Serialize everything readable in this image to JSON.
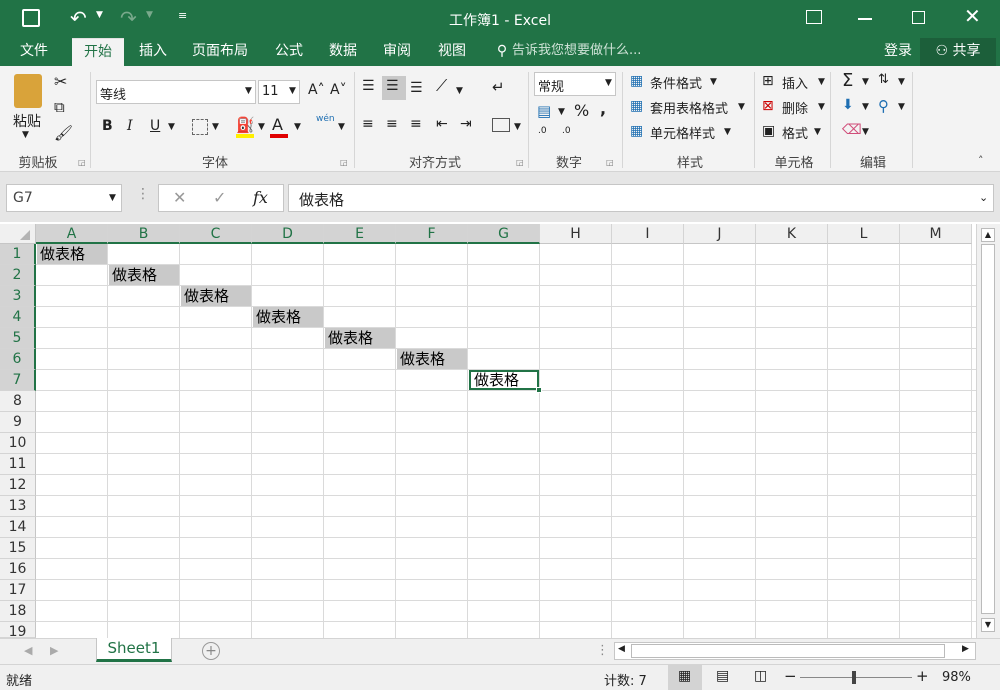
{
  "title": "工作簿1 - Excel",
  "tabs": [
    "文件",
    "开始",
    "插入",
    "页面布局",
    "公式",
    "数据",
    "审阅",
    "视图"
  ],
  "tell_me": "告诉我您想要做什么...",
  "login": "登录",
  "share": "共享",
  "ribbon": {
    "paste": "粘贴",
    "clipboard": "剪贴板",
    "font_name": "等线",
    "font_size": "11",
    "font_group": "字体",
    "align_group": "对齐方式",
    "number_format": "常规",
    "number_group": "数字",
    "cond_format": "条件格式",
    "table_format": "套用表格格式",
    "cell_style": "单元格样式",
    "styles_group": "样式",
    "insert": "插入",
    "delete": "删除",
    "format": "格式",
    "cells_group": "单元格",
    "edit_group": "编辑",
    "bold": "B",
    "italic": "I",
    "underline": "U",
    "pct": "%",
    "comma": ",",
    "phonetic": "wén",
    "inc_dec": ".0",
    "fx": "fx"
  },
  "namebox": "G7",
  "formula": "做表格",
  "columns": [
    "A",
    "B",
    "C",
    "D",
    "E",
    "F",
    "G",
    "H",
    "I",
    "J",
    "K",
    "L",
    "M"
  ],
  "rows": [
    "1",
    "2",
    "3",
    "4",
    "5",
    "6",
    "7",
    "8",
    "9",
    "10",
    "11",
    "12",
    "13",
    "14",
    "15",
    "16",
    "17",
    "18",
    "19"
  ],
  "cells": [
    "做表格",
    "做表格",
    "做表格",
    "做表格",
    "做表格",
    "做表格",
    "做表格"
  ],
  "sheet_tab": "Sheet1",
  "status": {
    "ready": "就绪",
    "count": "计数: 7",
    "zoom": "98%"
  },
  "colors": {
    "accent": "#217346",
    "selected_fill": "#c9c9c9"
  }
}
